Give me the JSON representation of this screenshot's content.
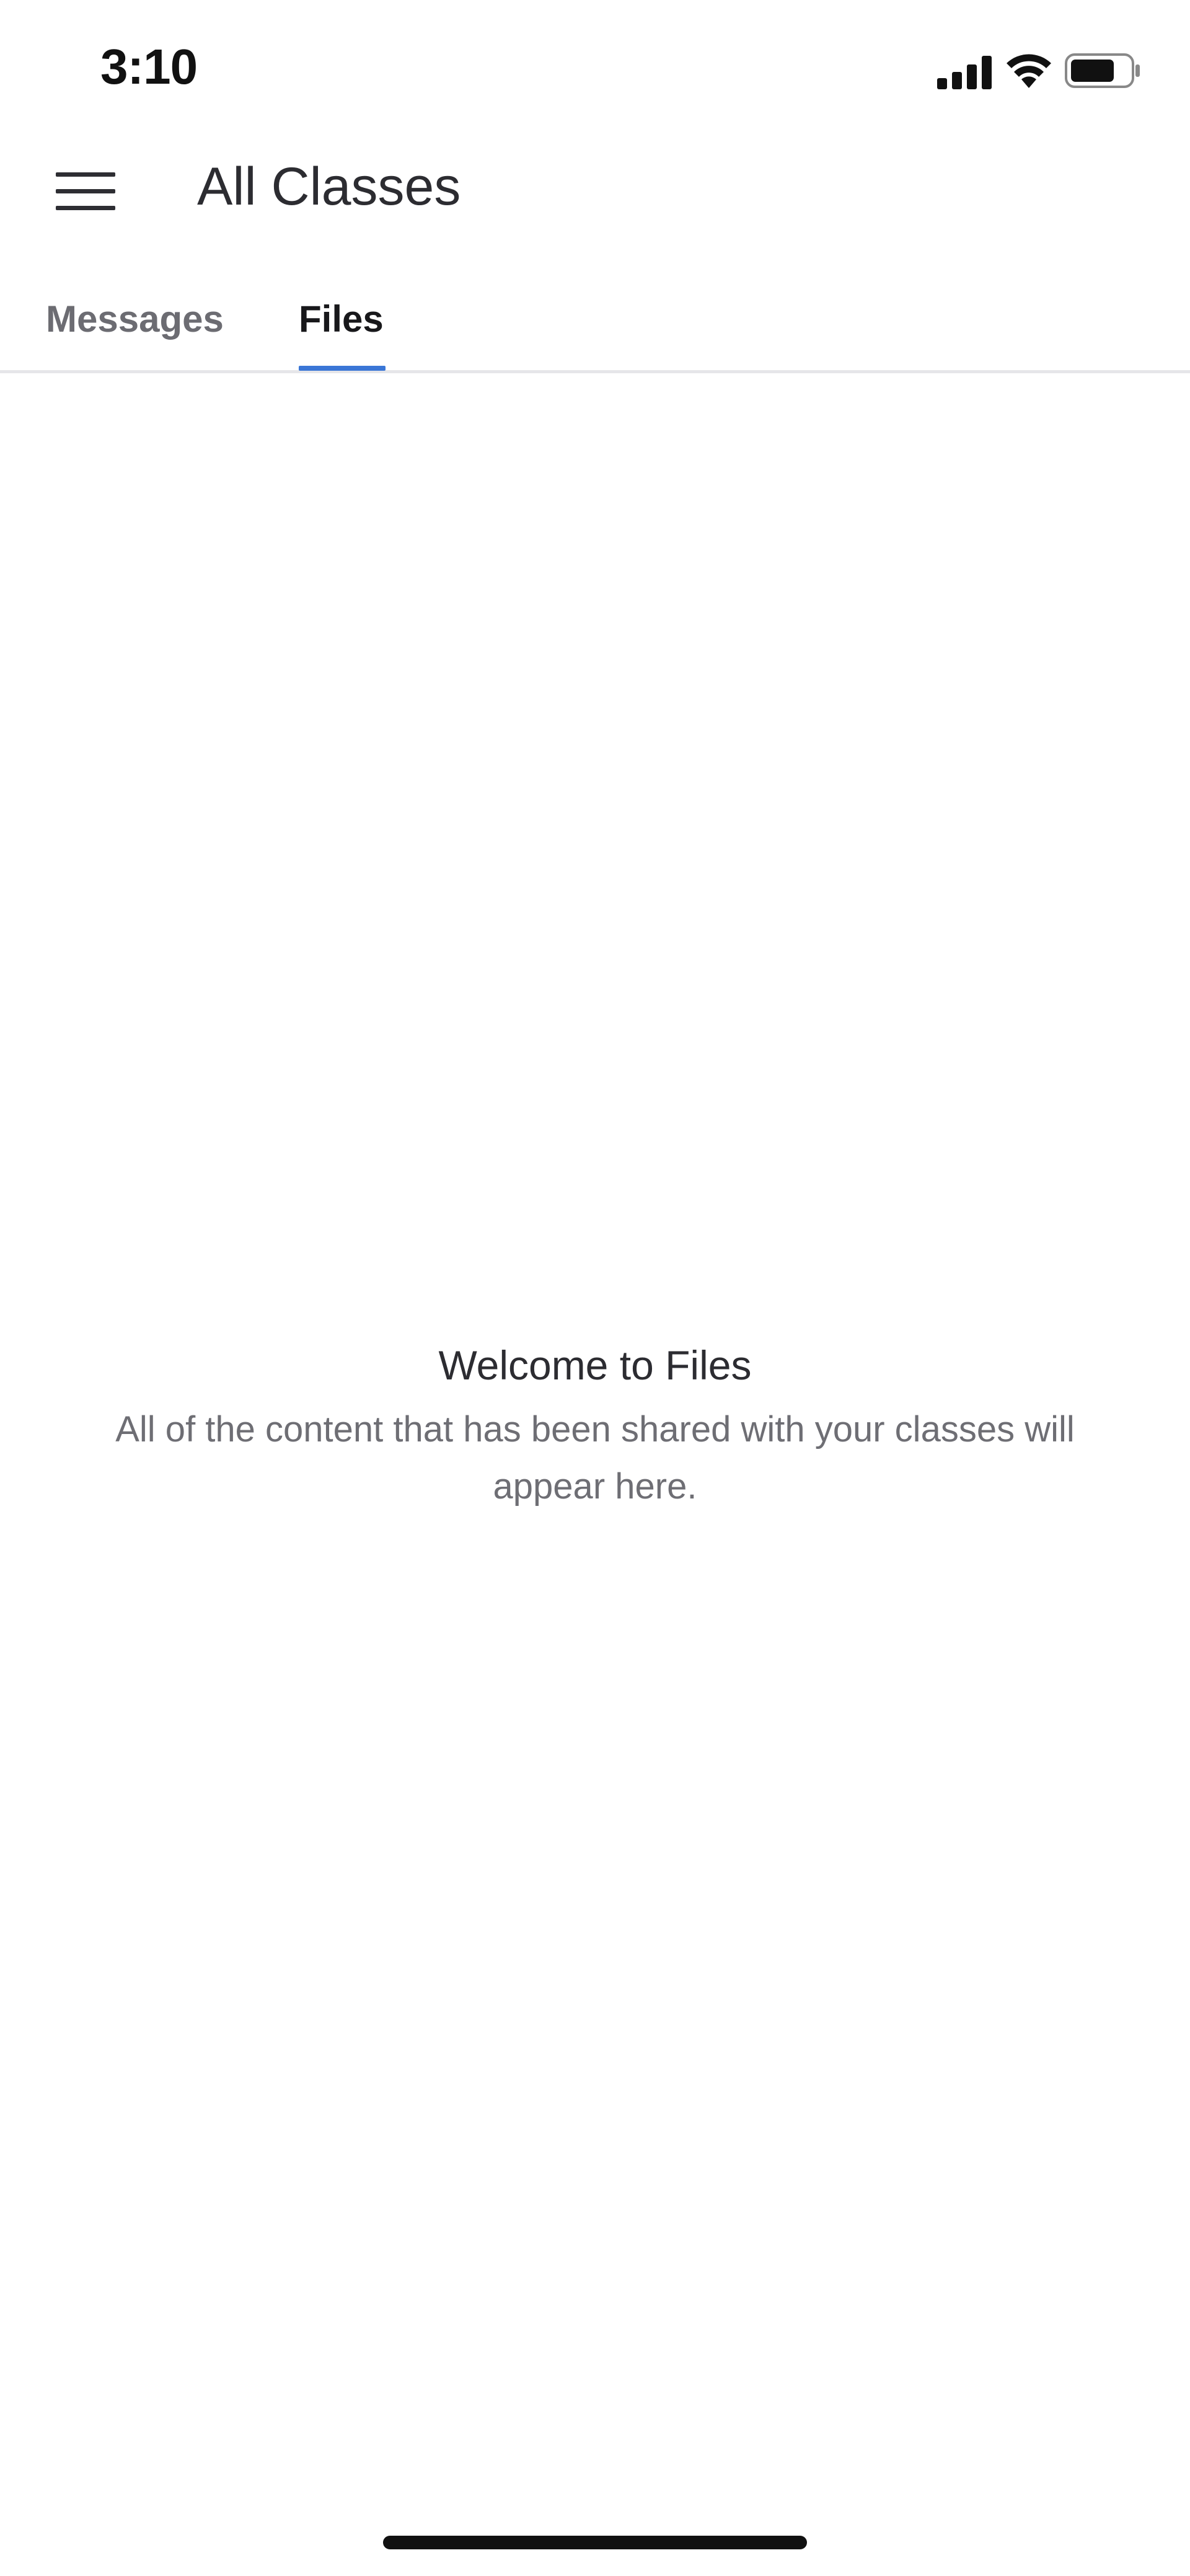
{
  "status_bar": {
    "time": "3:10",
    "signal_icon": "cellular-signal-icon",
    "wifi_icon": "wifi-icon",
    "battery_icon": "battery-icon",
    "battery_level": 0.75
  },
  "header": {
    "menu_icon": "hamburger-menu-icon",
    "title": "All Classes"
  },
  "tabs": [
    {
      "label": "Messages",
      "selected": false
    },
    {
      "label": "Files",
      "selected": true
    }
  ],
  "empty_state": {
    "title": "Welcome to Files",
    "subtitle": "All of the content that has been shared with your classes will appear here."
  },
  "colors": {
    "accent": "#3a76d6",
    "text_primary": "#2c2c31",
    "text_secondary": "#6e6e74",
    "background": "#ffffff"
  }
}
